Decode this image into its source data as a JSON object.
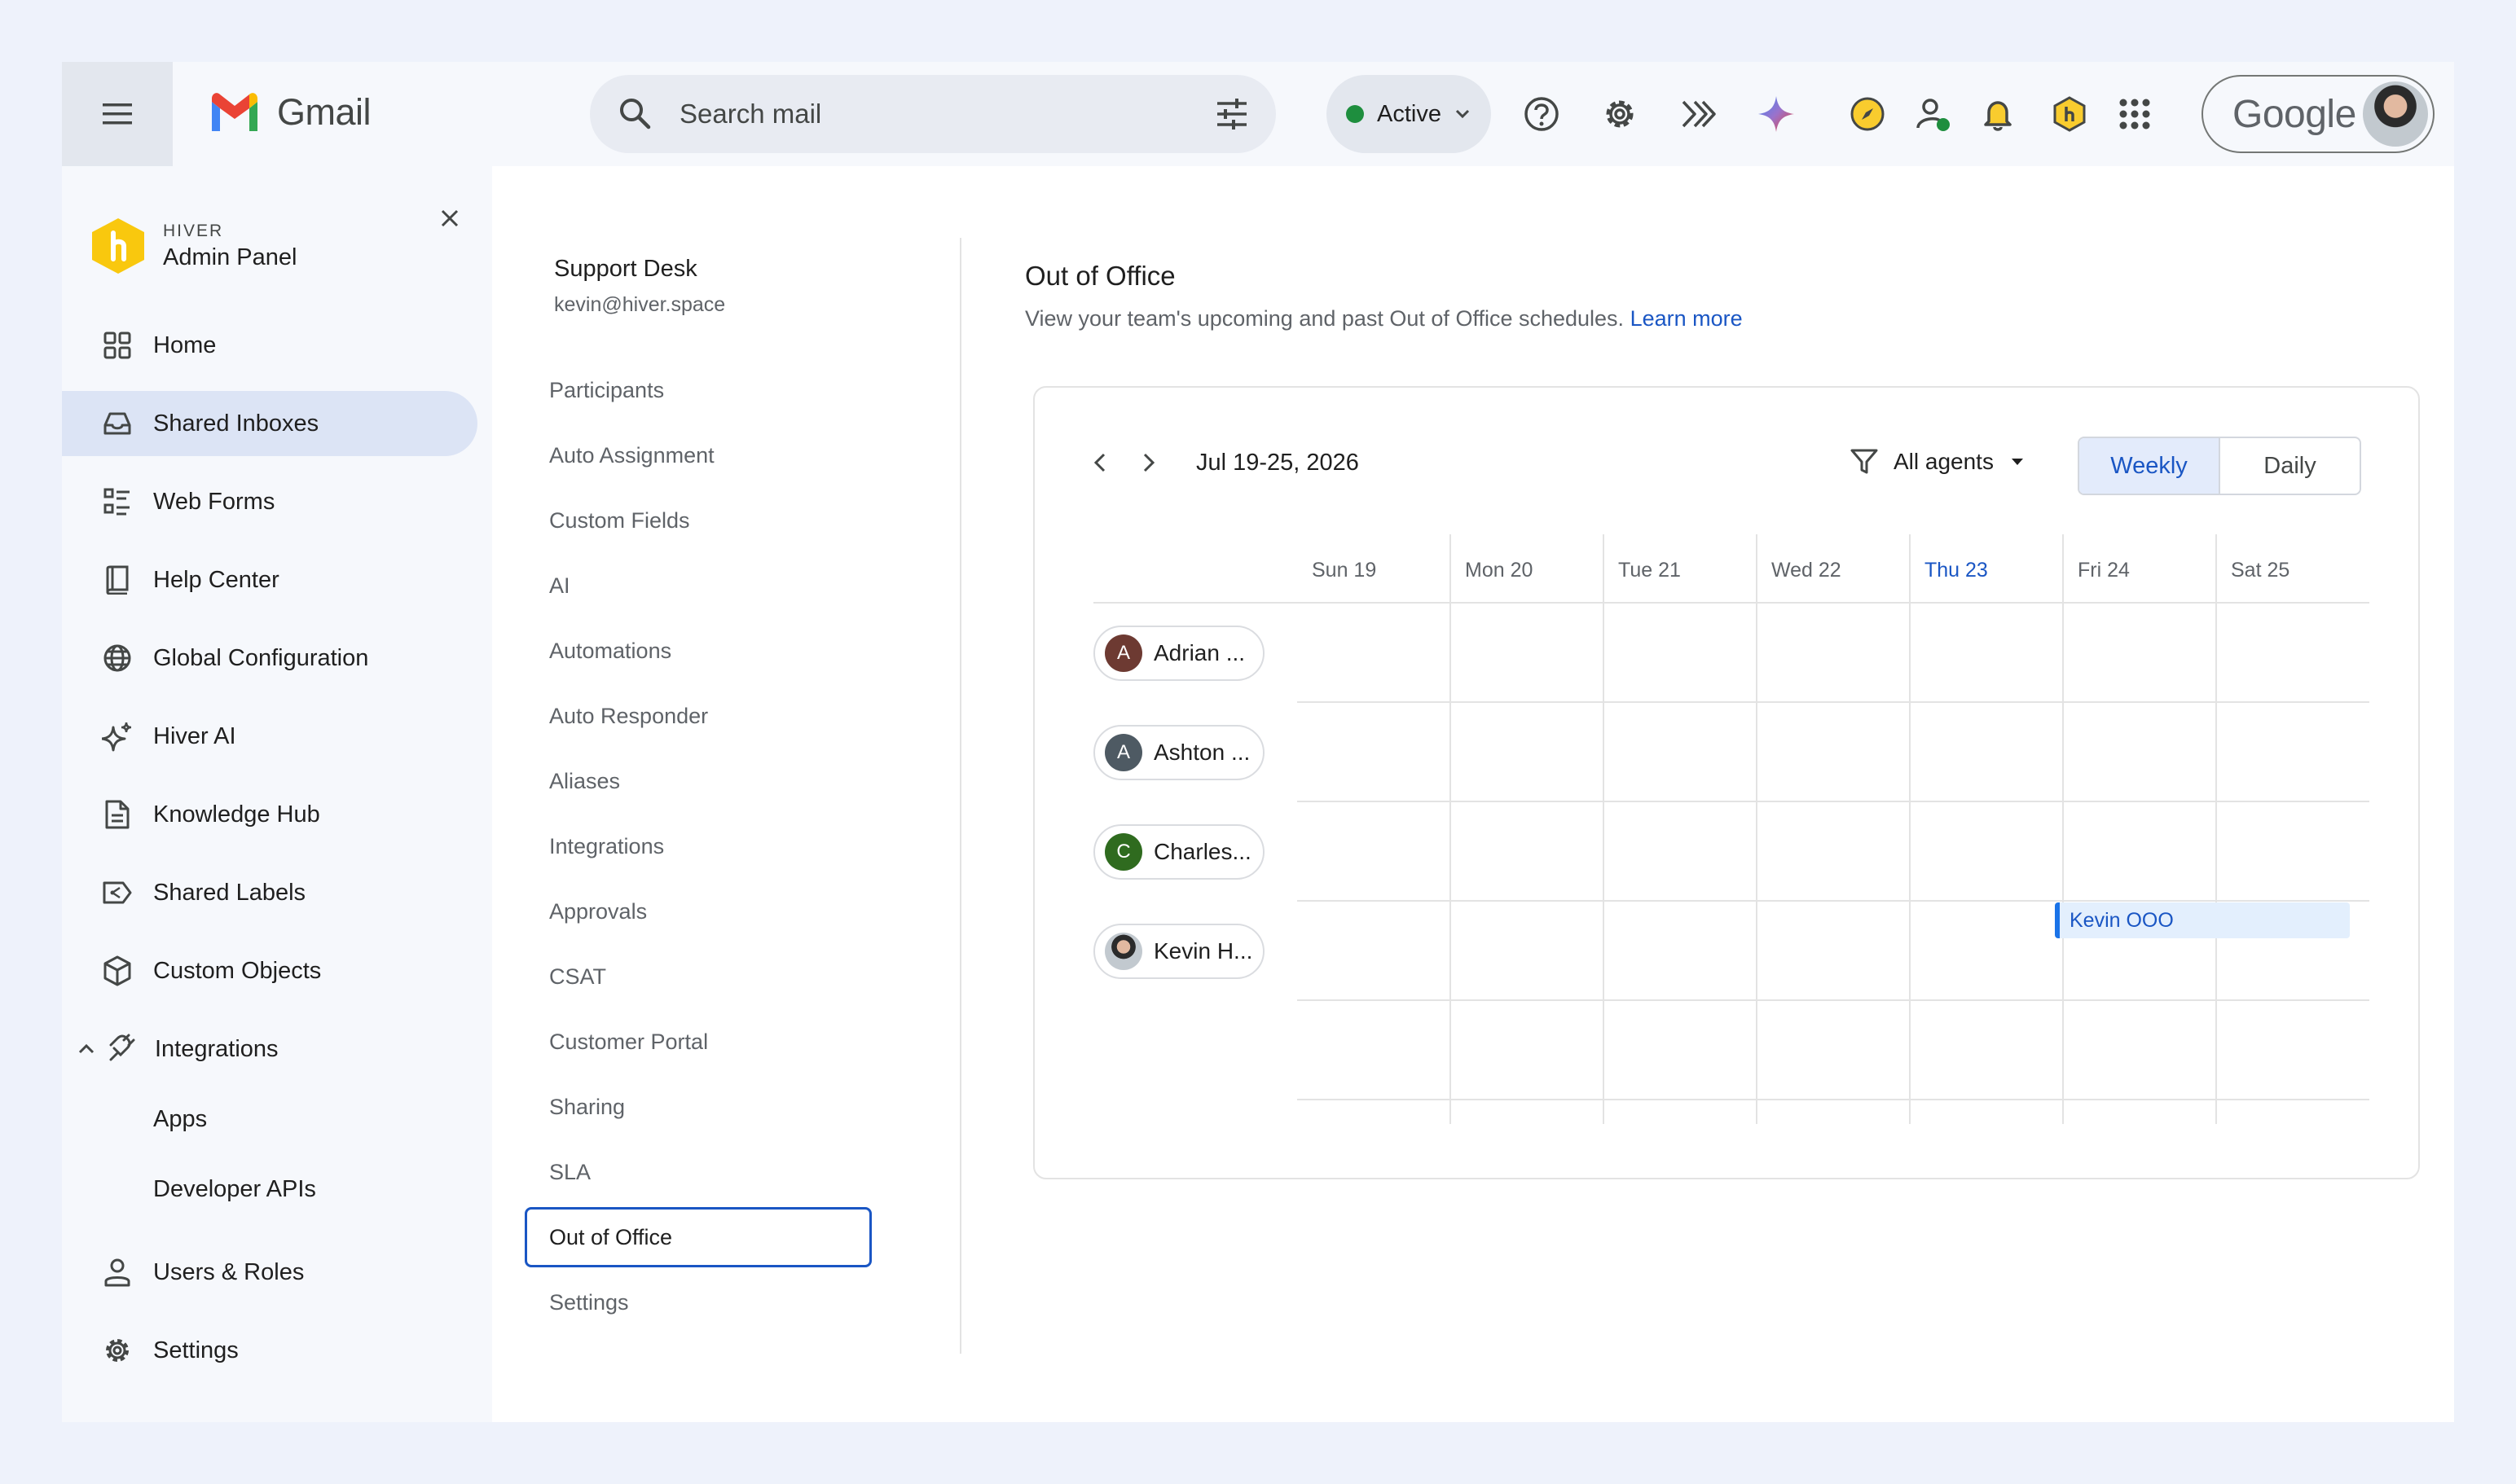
{
  "gmail": {
    "app_name": "Gmail",
    "search_placeholder": "Search mail",
    "status_label": "Active",
    "account_brand": "Google"
  },
  "sidebar": {
    "brand_small": "HIVER",
    "brand_title": "Admin Panel",
    "items": [
      {
        "label": "Home",
        "icon": "grid-icon"
      },
      {
        "label": "Shared Inboxes",
        "icon": "inbox-icon",
        "active": true
      },
      {
        "label": "Web Forms",
        "icon": "form-icon"
      },
      {
        "label": "Help Center",
        "icon": "book-icon"
      },
      {
        "label": "Global Configuration",
        "icon": "globe-icon"
      },
      {
        "label": "Hiver AI",
        "icon": "sparkle-icon"
      },
      {
        "label": "Knowledge Hub",
        "icon": "document-icon"
      },
      {
        "label": "Shared Labels",
        "icon": "label-icon"
      },
      {
        "label": "Custom Objects",
        "icon": "cube-icon"
      },
      {
        "label": "Integrations",
        "icon": "plug-icon",
        "expanded": true
      },
      {
        "label": "Apps"
      },
      {
        "label": "Developer APIs"
      },
      {
        "label": "Users & Roles",
        "icon": "user-icon"
      },
      {
        "label": "Settings",
        "icon": "gear-icon"
      }
    ]
  },
  "inbox": {
    "name": "Support Desk",
    "email": "kevin@hiver.space",
    "menu": [
      "Participants",
      "Auto Assignment",
      "Custom Fields",
      "AI",
      "Automations",
      "Auto Responder",
      "Aliases",
      "Integrations",
      "Approvals",
      "CSAT",
      "Customer Portal",
      "Sharing",
      "SLA",
      "Out of Office",
      "Settings"
    ],
    "active_item": "Out of Office"
  },
  "ooo": {
    "title": "Out of Office",
    "description": "View your team's upcoming and past Out of Office schedules.",
    "learn_more": "Learn more",
    "range": "Jul 19-25, 2026",
    "filter_label": "All agents",
    "view_weekly": "Weekly",
    "view_daily": "Daily",
    "days": [
      "Sun 19",
      "Mon 20",
      "Tue 21",
      "Wed 22",
      "Thu 23",
      "Fri 24",
      "Sat 25"
    ],
    "today": "Thu 23",
    "agents": [
      {
        "initial": "A",
        "name": "Adrian ...",
        "color": "#6d3a32"
      },
      {
        "initial": "A",
        "name": "Ashton ...",
        "color": "#4e5a63"
      },
      {
        "initial": "C",
        "name": "Charles...",
        "color": "#2f6b1f"
      },
      {
        "initial": "",
        "name": "Kevin H...",
        "color": "#3a3a3a"
      }
    ],
    "event": {
      "label": "Kevin OOO",
      "agent": "Kevin H...",
      "start_day": "Fri 24",
      "end_day": "Sat 25"
    }
  }
}
